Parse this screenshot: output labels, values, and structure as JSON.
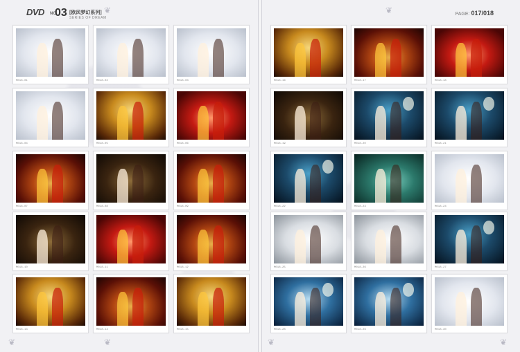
{
  "header": {
    "dvd": "DVD",
    "no": "NO.",
    "issue": "03",
    "series": "[欧风梦幻系列]",
    "series_en": "SERIES OF DREAM",
    "page_prefix": "PAGE:",
    "page": "017/018"
  },
  "left_page": {
    "cards": [
      {
        "code": "M018-01",
        "tone": "white"
      },
      {
        "code": "M018-02",
        "tone": "white"
      },
      {
        "code": "M018-03",
        "tone": "white"
      },
      {
        "code": "M018-04",
        "tone": "white"
      },
      {
        "code": "M018-05",
        "tone": "gold"
      },
      {
        "code": "M018-06",
        "tone": "red"
      },
      {
        "code": "M018-07",
        "tone": "warm"
      },
      {
        "code": "M018-08",
        "tone": "dark"
      },
      {
        "code": "M018-09",
        "tone": "warm"
      },
      {
        "code": "M018-10",
        "tone": "dark"
      },
      {
        "code": "M018-11",
        "tone": "red"
      },
      {
        "code": "M018-12",
        "tone": "warm"
      },
      {
        "code": "M018-13",
        "tone": "gold"
      },
      {
        "code": "M018-14",
        "tone": "warm"
      },
      {
        "code": "M018-15",
        "tone": "gold"
      }
    ]
  },
  "right_page": {
    "cards": [
      {
        "code": "M018-16",
        "tone": "gold"
      },
      {
        "code": "M018-17",
        "tone": "warm"
      },
      {
        "code": "M018-18",
        "tone": "red"
      },
      {
        "code": "M018-19",
        "tone": "dark"
      },
      {
        "code": "M018-20",
        "tone": "night"
      },
      {
        "code": "M018-21",
        "tone": "night"
      },
      {
        "code": "M018-22",
        "tone": "night"
      },
      {
        "code": "M018-23",
        "tone": "teal"
      },
      {
        "code": "M018-24",
        "tone": "white"
      },
      {
        "code": "M018-25",
        "tone": "ink"
      },
      {
        "code": "M018-26",
        "tone": "ink"
      },
      {
        "code": "M018-27",
        "tone": "night"
      },
      {
        "code": "M018-28",
        "tone": "blue"
      },
      {
        "code": "M018-29",
        "tone": "blue"
      },
      {
        "code": "M018-30",
        "tone": "white"
      }
    ]
  }
}
